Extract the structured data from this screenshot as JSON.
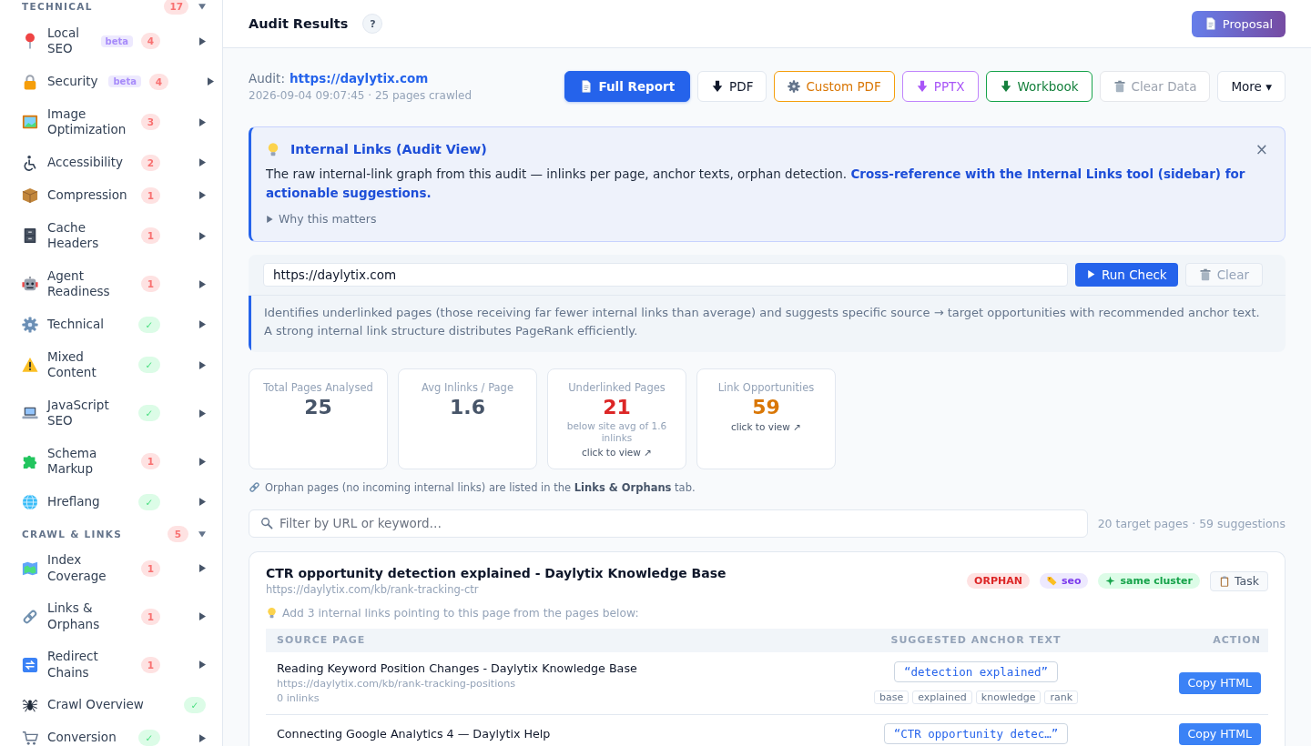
{
  "sidebar": {
    "sections": [
      {
        "title": "TECHNICAL",
        "count": "17",
        "expanded": true,
        "items": [
          {
            "label": "Local SEO",
            "tag": "beta",
            "badge": "4",
            "passed": false,
            "expandable": true
          },
          {
            "label": "Security",
            "tag": "beta",
            "badge": "4",
            "passed": false,
            "expandable": true
          },
          {
            "label": "Image Optimization",
            "badge": "3",
            "passed": false,
            "expandable": true
          },
          {
            "label": "Accessibility",
            "badge": "2",
            "passed": false,
            "expandable": true
          },
          {
            "label": "Compression",
            "badge": "1",
            "passed": false,
            "expandable": true
          },
          {
            "label": "Cache Headers",
            "badge": "1",
            "passed": false,
            "expandable": true
          },
          {
            "label": "Agent Readiness",
            "badge": "1",
            "passed": false,
            "expandable": true
          },
          {
            "label": "Technical",
            "badge": "✓",
            "passed": true,
            "expandable": true
          },
          {
            "label": "Mixed Content",
            "badge": "✓",
            "passed": true,
            "expandable": true
          },
          {
            "label": "JavaScript SEO",
            "badge": "✓",
            "passed": true,
            "expandable": true
          },
          {
            "label": "Schema Markup",
            "badge": "1",
            "passed": false,
            "expandable": true
          },
          {
            "label": "Hreflang",
            "badge": "✓",
            "passed": true,
            "expandable": true
          }
        ]
      },
      {
        "title": "CRAWL & LINKS",
        "count": "5",
        "expanded": true,
        "items": [
          {
            "label": "Index Coverage",
            "badge": "1",
            "passed": false,
            "expandable": true
          },
          {
            "label": "Links & Orphans",
            "badge": "1",
            "passed": false,
            "expandable": true
          },
          {
            "label": "Redirect Chains",
            "badge": "1",
            "passed": false,
            "expandable": true
          },
          {
            "label": "Crawl Overview",
            "badge": "✓",
            "passed": true,
            "expandable": false
          },
          {
            "label": "Conversion",
            "badge": "✓",
            "passed": true,
            "expandable": true
          }
        ]
      }
    ]
  },
  "header": {
    "title": "Audit Results",
    "help": "?",
    "action": "Proposal"
  },
  "audit": {
    "label": "Audit:",
    "url": "https://daylytix.com",
    "meta": "2026-09-04 09:07:45 · 25 pages crawled",
    "buttons": [
      {
        "label": "Full Report",
        "kind": "primary",
        "disabled": false
      },
      {
        "label": "PDF",
        "kind": "plain",
        "disabled": false
      },
      {
        "label": "Custom PDF",
        "kind": "amber",
        "disabled": false
      },
      {
        "label": "PPTX",
        "kind": "purple",
        "disabled": false
      },
      {
        "label": "Workbook",
        "kind": "green",
        "disabled": false
      },
      {
        "label": "Clear Data",
        "kind": "plain",
        "disabled": true
      },
      {
        "label": "More ▾",
        "kind": "plain",
        "disabled": false
      }
    ]
  },
  "callout": {
    "title": "Internal Links (Audit View)",
    "body": "The raw internal-link graph from this audit — inlinks per page, anchor texts, orphan detection. **Cross-reference with the Internal Links tool (sidebar) for actionable suggestions.**",
    "toggle": "Why this matters",
    "expanded": false,
    "close": "×"
  },
  "check": {
    "url": "https://daylytix.com",
    "run": "Run Check",
    "clear": {
      "label": "Clear",
      "disabled": true
    },
    "description": "Identifies underlinked pages (those receiving far fewer internal links than average) and suggests specific source → target opportunities with recommended anchor text. A strong internal link structure distributes PageRank efficiently."
  },
  "stats": [
    {
      "label": "Total Pages Analysed",
      "value": "25",
      "color": "#475569"
    },
    {
      "label": "Avg Inlinks / Page",
      "value": "1.6",
      "color": "#475569"
    },
    {
      "label": "Underlinked Pages",
      "value": "21",
      "color": "#dc2626",
      "note": "below site avg of 1.6 inlinks",
      "link": "click to view ↗"
    },
    {
      "label": "Link Opportunities",
      "value": "59",
      "color": "#d97706",
      "link": "click to view ↗"
    }
  ],
  "orphan_note": "Orphan pages (no incoming internal links) are listed in the **Links & Orphans** tab.",
  "filter": {
    "placeholder": "Filter by URL or keyword…",
    "summary": "20 target pages · 59 suggestions"
  },
  "targets": [
    {
      "title": "CTR opportunity detection explained - Daylytix Knowledge Base",
      "url": "https://daylytix.com/kb/rank-tracking-ctr",
      "tags": [
        {
          "label": "ORPHAN",
          "kind": "orphan"
        },
        {
          "label": "seo",
          "kind": "topic"
        },
        {
          "label": "same cluster",
          "kind": "cluster"
        }
      ],
      "task": "Task",
      "hint": "Add 3 internal links pointing to this page from the pages below:",
      "columns": [
        "SOURCE PAGE",
        "SUGGESTED ANCHOR TEXT",
        "ACTION"
      ],
      "rows": [
        {
          "title": "Reading Keyword Position Changes - Daylytix Knowledge Base",
          "url": "https://daylytix.com/kb/rank-tracking-positions",
          "inlinks": "0 inlinks",
          "anchor": "“detection explained”",
          "keywords": [
            "base",
            "explained",
            "knowledge",
            "rank"
          ],
          "action": "Copy HTML"
        },
        {
          "title": "Connecting Google Analytics 4 — Daylytix Help",
          "anchor": "“CTR opportunity detec…”",
          "action": "Copy HTML"
        }
      ]
    }
  ]
}
